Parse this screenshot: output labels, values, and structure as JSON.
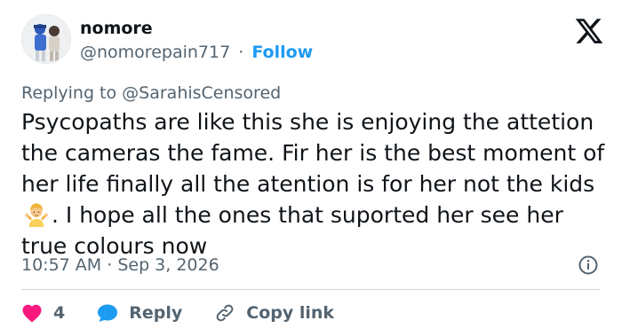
{
  "user": {
    "display_name": "nomore",
    "handle": "@nomorepain717",
    "separator": "·",
    "follow_label": "Follow"
  },
  "reply": {
    "prefix": "Replying to ",
    "mention": "@SarahisCensored"
  },
  "tweet": {
    "text_before_emoji": "Psycopaths are like this she is enjoying the attetion the cameras the fame. Fir her is the best moment of her life finally all the atention is for her not the kids ",
    "text_after_emoji": ". I hope all the ones that suported her see her true colours now",
    "emoji_icon": "person-shrugging-icon"
  },
  "meta": {
    "time": "10:57 AM",
    "separator": "·",
    "date": "Sep 3, 2026"
  },
  "actions": {
    "like_count": "4",
    "reply_label": "Reply",
    "copy_link_label": "Copy link"
  },
  "colors": {
    "accent": "#1d9bf0",
    "heart": "#f91880",
    "text": "#0f1419",
    "muted": "#536471"
  }
}
